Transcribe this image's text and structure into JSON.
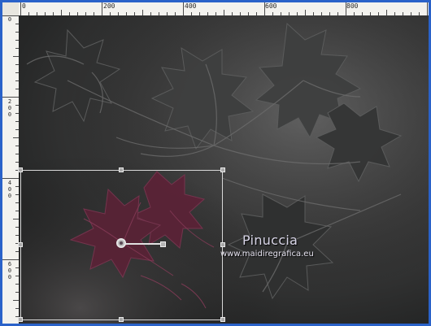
{
  "app": {
    "accent_color": "#2a62c9",
    "ruler_color": "#f3f2ee"
  },
  "rulers": {
    "horizontal_labels": [
      "0",
      "200",
      "400",
      "600",
      "800"
    ],
    "vertical_labels": [
      "0",
      "200",
      "400",
      "600"
    ]
  },
  "canvas": {
    "watermark_title": "Pinuccia",
    "watermark_url": "www.maidiregrafica.eu",
    "leaf_color": "#6b2d45",
    "background_color": "#2b2c2c"
  },
  "transform_tool": {
    "selection_color": "#d8d8d8",
    "handle_icon": "square-handle-icon",
    "pivot_icon": "rotation-pivot-icon"
  }
}
